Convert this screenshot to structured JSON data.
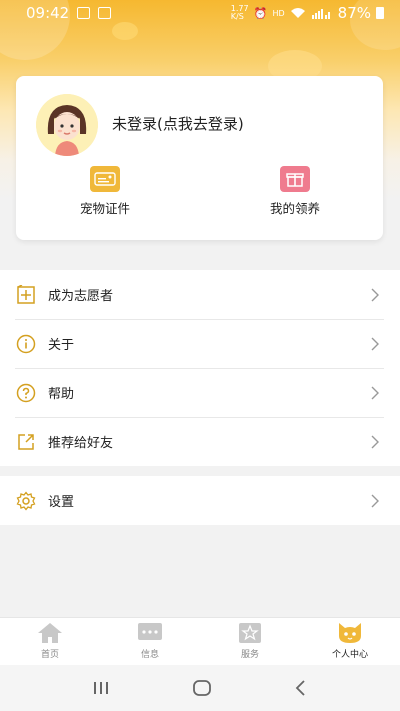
{
  "status_bar": {
    "time": "09:42",
    "speed": "1.77 K/S",
    "hd": "HD",
    "battery_pct": "87%"
  },
  "profile": {
    "login_prompt": "未登录(点我去登录)"
  },
  "quick_actions": [
    {
      "label": "宠物证件",
      "icon": "id-card-icon",
      "color": "#f0b83a"
    },
    {
      "label": "我的领养",
      "icon": "gift-icon",
      "color": "#ef7b8e"
    }
  ],
  "menu": [
    {
      "label": "成为志愿者",
      "icon": "volunteer-flag-icon"
    },
    {
      "label": "关于",
      "icon": "info-icon"
    },
    {
      "label": "帮助",
      "icon": "help-icon"
    },
    {
      "label": "推荐给好友",
      "icon": "share-icon"
    }
  ],
  "menu_settings": {
    "label": "设置",
    "icon": "gear-icon"
  },
  "tabs": [
    {
      "label": "首页",
      "icon": "home-icon"
    },
    {
      "label": "信息",
      "icon": "message-icon"
    },
    {
      "label": "服务",
      "icon": "star-icon"
    },
    {
      "label": "个人中心",
      "icon": "cat-face-icon",
      "active": true
    }
  ],
  "colors": {
    "accent": "#f0b83a",
    "pink": "#ef7b8e",
    "icon_gold": "#d4a020",
    "tab_inactive": "#c8c8c8"
  }
}
